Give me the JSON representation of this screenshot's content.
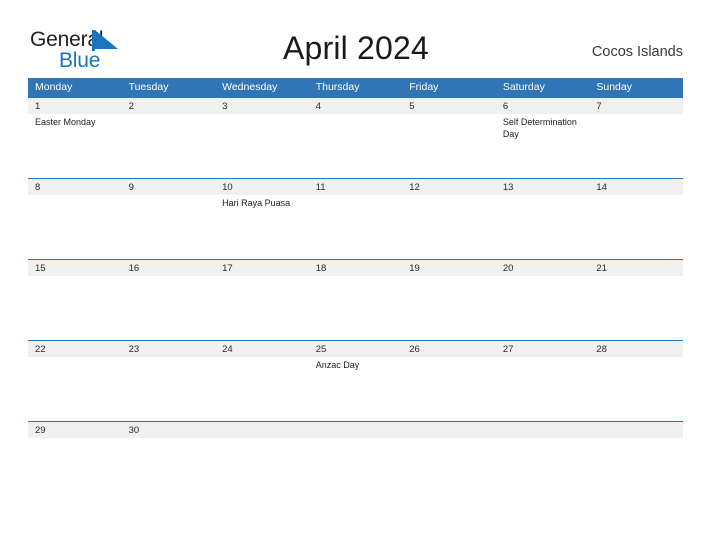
{
  "brand": {
    "name_part1": "General",
    "name_part2": "Blue",
    "flag_icon": "blue-flag-triangle",
    "color_dark": "#231f20",
    "color_blue": "#1b75bc"
  },
  "header": {
    "title": "April 2024",
    "region": "Cocos Islands"
  },
  "theme": {
    "header_blue": "#3075b5",
    "row_divider_blue": "#2e75b6",
    "number_band_gray": "#f0f0f0",
    "page_background": "#ffffff"
  },
  "calendar": {
    "month": "April",
    "year": "2024",
    "weekday_headers": [
      "Monday",
      "Tuesday",
      "Wednesday",
      "Thursday",
      "Friday",
      "Saturday",
      "Sunday"
    ],
    "weeks": [
      {
        "days": [
          {
            "number": "1",
            "event": "Easter Monday"
          },
          {
            "number": "2",
            "event": ""
          },
          {
            "number": "3",
            "event": ""
          },
          {
            "number": "4",
            "event": ""
          },
          {
            "number": "5",
            "event": ""
          },
          {
            "number": "6",
            "event": "Self Determination Day"
          },
          {
            "number": "7",
            "event": ""
          }
        ]
      },
      {
        "days": [
          {
            "number": "8",
            "event": ""
          },
          {
            "number": "9",
            "event": ""
          },
          {
            "number": "10",
            "event": "Hari Raya Puasa"
          },
          {
            "number": "11",
            "event": ""
          },
          {
            "number": "12",
            "event": ""
          },
          {
            "number": "13",
            "event": ""
          },
          {
            "number": "14",
            "event": ""
          }
        ]
      },
      {
        "days": [
          {
            "number": "15",
            "event": ""
          },
          {
            "number": "16",
            "event": ""
          },
          {
            "number": "17",
            "event": ""
          },
          {
            "number": "18",
            "event": ""
          },
          {
            "number": "19",
            "event": ""
          },
          {
            "number": "20",
            "event": ""
          },
          {
            "number": "21",
            "event": ""
          }
        ]
      },
      {
        "days": [
          {
            "number": "22",
            "event": ""
          },
          {
            "number": "23",
            "event": ""
          },
          {
            "number": "24",
            "event": ""
          },
          {
            "number": "25",
            "event": "Anzac Day"
          },
          {
            "number": "26",
            "event": ""
          },
          {
            "number": "27",
            "event": ""
          },
          {
            "number": "28",
            "event": ""
          }
        ]
      },
      {
        "days": [
          {
            "number": "29",
            "event": ""
          },
          {
            "number": "30",
            "event": ""
          },
          {
            "number": "",
            "event": ""
          },
          {
            "number": "",
            "event": ""
          },
          {
            "number": "",
            "event": ""
          },
          {
            "number": "",
            "event": ""
          },
          {
            "number": "",
            "event": ""
          }
        ]
      }
    ]
  }
}
